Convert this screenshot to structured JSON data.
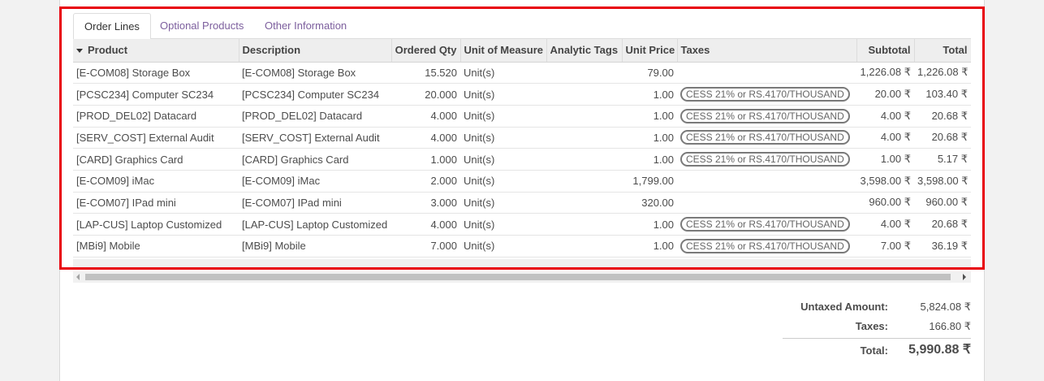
{
  "tabs": [
    {
      "label": "Order Lines",
      "active": true
    },
    {
      "label": "Optional Products",
      "active": false
    },
    {
      "label": "Other Information",
      "active": false
    }
  ],
  "columns": {
    "product": "Product",
    "description": "Description",
    "ordered_qty": "Ordered Qty",
    "uom": "Unit of Measure",
    "analytic_tags": "Analytic Tags",
    "unit_price": "Unit Price",
    "taxes": "Taxes",
    "subtotal": "Subtotal",
    "total": "Total"
  },
  "rows": [
    {
      "product": "[E-COM08] Storage Box",
      "description": "[E-COM08] Storage Box",
      "qty": "15.520",
      "uom": "Unit(s)",
      "tags": "",
      "price": "79.00",
      "tax": "",
      "subtotal": "1,226.08 ₹",
      "total": "1,226.08 ₹"
    },
    {
      "product": "[PCSC234] Computer SC234",
      "description": "[PCSC234] Computer SC234",
      "qty": "20.000",
      "uom": "Unit(s)",
      "tags": "",
      "price": "1.00",
      "tax": "CESS 21% or RS.4170/THOUSAND",
      "subtotal": "20.00 ₹",
      "total": "103.40 ₹"
    },
    {
      "product": "[PROD_DEL02] Datacard",
      "description": "[PROD_DEL02] Datacard",
      "qty": "4.000",
      "uom": "Unit(s)",
      "tags": "",
      "price": "1.00",
      "tax": "CESS 21% or RS.4170/THOUSAND",
      "subtotal": "4.00 ₹",
      "total": "20.68 ₹"
    },
    {
      "product": "[SERV_COST] External Audit",
      "description": "[SERV_COST] External Audit",
      "qty": "4.000",
      "uom": "Unit(s)",
      "tags": "",
      "price": "1.00",
      "tax": "CESS 21% or RS.4170/THOUSAND",
      "subtotal": "4.00 ₹",
      "total": "20.68 ₹"
    },
    {
      "product": "[CARD] Graphics Card",
      "description": "[CARD] Graphics Card",
      "qty": "1.000",
      "uom": "Unit(s)",
      "tags": "",
      "price": "1.00",
      "tax": "CESS 21% or RS.4170/THOUSAND",
      "subtotal": "1.00 ₹",
      "total": "5.17 ₹"
    },
    {
      "product": "[E-COM09] iMac",
      "description": "[E-COM09] iMac",
      "qty": "2.000",
      "uom": "Unit(s)",
      "tags": "",
      "price": "1,799.00",
      "tax": "",
      "subtotal": "3,598.00 ₹",
      "total": "3,598.00 ₹"
    },
    {
      "product": "[E-COM07] IPad mini",
      "description": "[E-COM07] IPad mini",
      "qty": "3.000",
      "uom": "Unit(s)",
      "tags": "",
      "price": "320.00",
      "tax": "",
      "subtotal": "960.00 ₹",
      "total": "960.00 ₹"
    },
    {
      "product": "[LAP-CUS] Laptop Customized",
      "description": "[LAP-CUS] Laptop Customized",
      "qty": "4.000",
      "uom": "Unit(s)",
      "tags": "",
      "price": "1.00",
      "tax": "CESS 21% or RS.4170/THOUSAND",
      "subtotal": "4.00 ₹",
      "total": "20.68 ₹"
    },
    {
      "product": "[MBi9] Mobile",
      "description": "[MBi9] Mobile",
      "qty": "7.000",
      "uom": "Unit(s)",
      "tags": "",
      "price": "1.00",
      "tax": "CESS 21% or RS.4170/THOUSAND",
      "subtotal": "7.00 ₹",
      "total": "36.19 ₹"
    }
  ],
  "totals": {
    "untaxed_label": "Untaxed Amount:",
    "untaxed_value": "5,824.08 ₹",
    "taxes_label": "Taxes:",
    "taxes_value": "166.80 ₹",
    "total_label": "Total:",
    "total_value": "5,990.88 ₹"
  },
  "colors": {
    "highlight": "#e8000b",
    "tab_link": "#7c5e9d"
  }
}
